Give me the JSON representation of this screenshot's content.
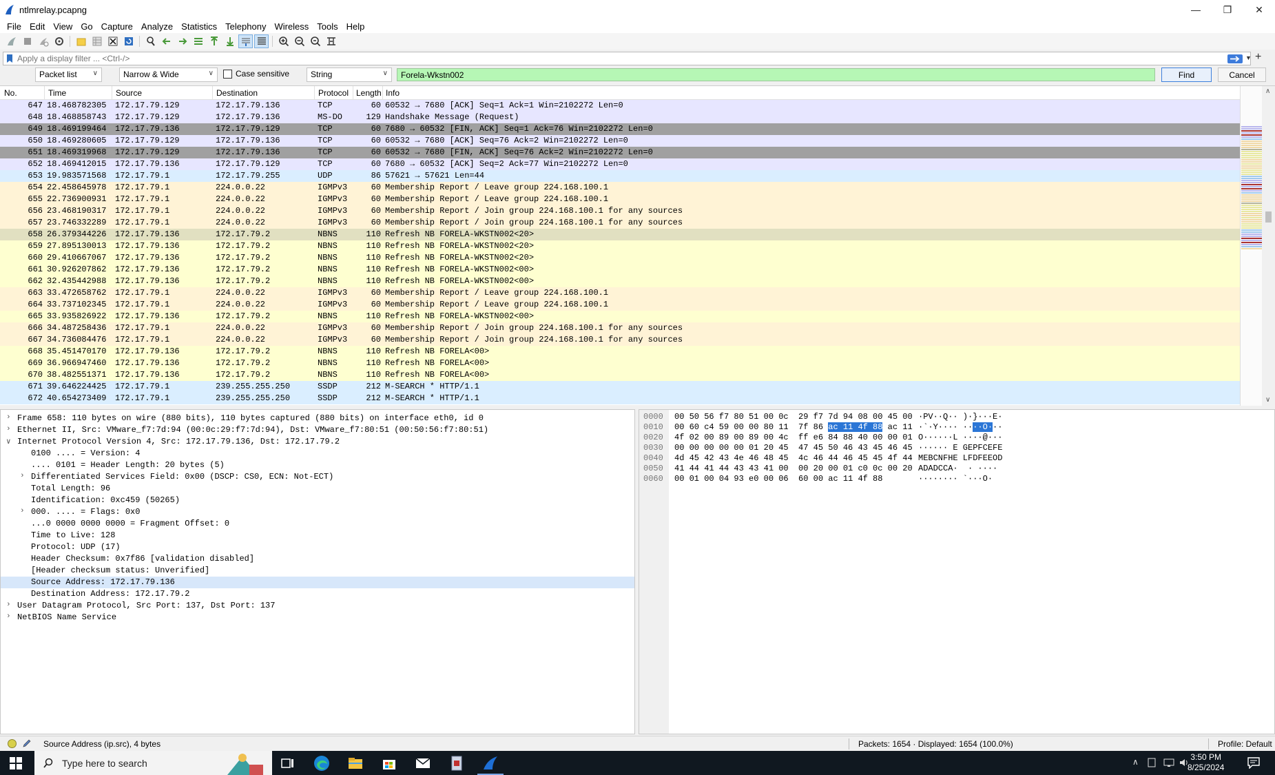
{
  "window": {
    "title": "ntlmrelay.pcapng"
  },
  "menu": [
    "File",
    "Edit",
    "View",
    "Go",
    "Capture",
    "Analyze",
    "Statistics",
    "Telephony",
    "Wireless",
    "Tools",
    "Help"
  ],
  "filter": {
    "placeholder": "Apply a display filter ... <Ctrl-/>"
  },
  "find": {
    "search_in": "Packet list",
    "char_width": "Narrow & Wide",
    "case_sensitive_label": "Case sensitive",
    "case_sensitive": false,
    "search_type": "String",
    "query": "Forela-Wkstn002",
    "find_label": "Find",
    "cancel_label": "Cancel"
  },
  "packet_list": {
    "columns": [
      "No.",
      "Time",
      "Source",
      "Destination",
      "Protocol",
      "Length",
      "Info"
    ],
    "rows": [
      {
        "no": "647",
        "time": "18.468782305",
        "src": "172.17.79.129",
        "dst": "172.17.79.136",
        "proto": "TCP",
        "len": "60",
        "info": "60532 → 7680 [ACK] Seq=1 Ack=1 Win=2102272 Len=0",
        "cls": "bg-tcp"
      },
      {
        "no": "648",
        "time": "18.468858743",
        "src": "172.17.79.129",
        "dst": "172.17.79.136",
        "proto": "MS-DO",
        "len": "129",
        "info": "Handshake Message (Request)",
        "cls": "bg-tcp"
      },
      {
        "no": "649",
        "time": "18.469199464",
        "src": "172.17.79.136",
        "dst": "172.17.79.129",
        "proto": "TCP",
        "len": "60",
        "info": "7680 → 60532 [FIN, ACK] Seq=1 Ack=76 Win=2102272 Len=0",
        "cls": "bg-tcpdark"
      },
      {
        "no": "650",
        "time": "18.469280605",
        "src": "172.17.79.129",
        "dst": "172.17.79.136",
        "proto": "TCP",
        "len": "60",
        "info": "60532 → 7680 [ACK] Seq=76 Ack=2 Win=2102272 Len=0",
        "cls": "bg-tcp"
      },
      {
        "no": "651",
        "time": "18.469319968",
        "src": "172.17.79.129",
        "dst": "172.17.79.136",
        "proto": "TCP",
        "len": "60",
        "info": "60532 → 7680 [FIN, ACK] Seq=76 Ack=2 Win=2102272 Len=0",
        "cls": "bg-tcpdark"
      },
      {
        "no": "652",
        "time": "18.469412015",
        "src": "172.17.79.136",
        "dst": "172.17.79.129",
        "proto": "TCP",
        "len": "60",
        "info": "7680 → 60532 [ACK] Seq=2 Ack=77 Win=2102272 Len=0",
        "cls": "bg-tcp"
      },
      {
        "no": "653",
        "time": "19.983571568",
        "src": "172.17.79.1",
        "dst": "172.17.79.255",
        "proto": "UDP",
        "len": "86",
        "info": "57621 → 57621 Len=44",
        "cls": "bg-udp"
      },
      {
        "no": "654",
        "time": "22.458645978",
        "src": "172.17.79.1",
        "dst": "224.0.0.22",
        "proto": "IGMPv3",
        "len": "60",
        "info": "Membership Report / Leave group 224.168.100.1",
        "cls": "bg-igmp"
      },
      {
        "no": "655",
        "time": "22.736900931",
        "src": "172.17.79.1",
        "dst": "224.0.0.22",
        "proto": "IGMPv3",
        "len": "60",
        "info": "Membership Report / Leave group 224.168.100.1",
        "cls": "bg-igmp"
      },
      {
        "no": "656",
        "time": "23.468190317",
        "src": "172.17.79.1",
        "dst": "224.0.0.22",
        "proto": "IGMPv3",
        "len": "60",
        "info": "Membership Report / Join group 224.168.100.1 for any sources",
        "cls": "bg-igmp"
      },
      {
        "no": "657",
        "time": "23.746332289",
        "src": "172.17.79.1",
        "dst": "224.0.0.22",
        "proto": "IGMPv3",
        "len": "60",
        "info": "Membership Report / Join group 224.168.100.1 for any sources",
        "cls": "bg-igmp"
      },
      {
        "no": "658",
        "time": "26.379344226",
        "src": "172.17.79.136",
        "dst": "172.17.79.2",
        "proto": "NBNS",
        "len": "110",
        "info": "Refresh NB FORELA-WKSTN002<20>",
        "cls": "bg-nbnssel"
      },
      {
        "no": "659",
        "time": "27.895130013",
        "src": "172.17.79.136",
        "dst": "172.17.79.2",
        "proto": "NBNS",
        "len": "110",
        "info": "Refresh NB FORELA-WKSTN002<20>",
        "cls": "bg-nbns"
      },
      {
        "no": "660",
        "time": "29.410667067",
        "src": "172.17.79.136",
        "dst": "172.17.79.2",
        "proto": "NBNS",
        "len": "110",
        "info": "Refresh NB FORELA-WKSTN002<20>",
        "cls": "bg-nbns"
      },
      {
        "no": "661",
        "time": "30.926207862",
        "src": "172.17.79.136",
        "dst": "172.17.79.2",
        "proto": "NBNS",
        "len": "110",
        "info": "Refresh NB FORELA-WKSTN002<00>",
        "cls": "bg-nbns"
      },
      {
        "no": "662",
        "time": "32.435442988",
        "src": "172.17.79.136",
        "dst": "172.17.79.2",
        "proto": "NBNS",
        "len": "110",
        "info": "Refresh NB FORELA-WKSTN002<00>",
        "cls": "bg-nbns"
      },
      {
        "no": "663",
        "time": "33.472658762",
        "src": "172.17.79.1",
        "dst": "224.0.0.22",
        "proto": "IGMPv3",
        "len": "60",
        "info": "Membership Report / Leave group 224.168.100.1",
        "cls": "bg-igmp"
      },
      {
        "no": "664",
        "time": "33.737102345",
        "src": "172.17.79.1",
        "dst": "224.0.0.22",
        "proto": "IGMPv3",
        "len": "60",
        "info": "Membership Report / Leave group 224.168.100.1",
        "cls": "bg-igmp"
      },
      {
        "no": "665",
        "time": "33.935826922",
        "src": "172.17.79.136",
        "dst": "172.17.79.2",
        "proto": "NBNS",
        "len": "110",
        "info": "Refresh NB FORELA-WKSTN002<00>",
        "cls": "bg-nbns"
      },
      {
        "no": "666",
        "time": "34.487258436",
        "src": "172.17.79.1",
        "dst": "224.0.0.22",
        "proto": "IGMPv3",
        "len": "60",
        "info": "Membership Report / Join group 224.168.100.1 for any sources",
        "cls": "bg-igmp"
      },
      {
        "no": "667",
        "time": "34.736084476",
        "src": "172.17.79.1",
        "dst": "224.0.0.22",
        "proto": "IGMPv3",
        "len": "60",
        "info": "Membership Report / Join group 224.168.100.1 for any sources",
        "cls": "bg-igmp"
      },
      {
        "no": "668",
        "time": "35.451470170",
        "src": "172.17.79.136",
        "dst": "172.17.79.2",
        "proto": "NBNS",
        "len": "110",
        "info": "Refresh NB FORELA<00>",
        "cls": "bg-nbns"
      },
      {
        "no": "669",
        "time": "36.966947460",
        "src": "172.17.79.136",
        "dst": "172.17.79.2",
        "proto": "NBNS",
        "len": "110",
        "info": "Refresh NB FORELA<00>",
        "cls": "bg-nbns"
      },
      {
        "no": "670",
        "time": "38.482551371",
        "src": "172.17.79.136",
        "dst": "172.17.79.2",
        "proto": "NBNS",
        "len": "110",
        "info": "Refresh NB FORELA<00>",
        "cls": "bg-nbns"
      },
      {
        "no": "671",
        "time": "39.646224425",
        "src": "172.17.79.1",
        "dst": "239.255.255.250",
        "proto": "SSDP",
        "len": "212",
        "info": "M-SEARCH * HTTP/1.1",
        "cls": "bg-ssdp"
      },
      {
        "no": "672",
        "time": "40.654273409",
        "src": "172.17.79.1",
        "dst": "239.255.255.250",
        "proto": "SSDP",
        "len": "212",
        "info": "M-SEARCH * HTTP/1.1",
        "cls": "bg-ssdp"
      }
    ]
  },
  "details": [
    {
      "indent": 0,
      "exp": ">",
      "text": "Frame 658: 110 bytes on wire (880 bits), 110 bytes captured (880 bits) on interface eth0, id 0"
    },
    {
      "indent": 0,
      "exp": ">",
      "text": "Ethernet II, Src: VMware_f7:7d:94 (00:0c:29:f7:7d:94), Dst: VMware_f7:80:51 (00:50:56:f7:80:51)"
    },
    {
      "indent": 0,
      "exp": "v",
      "text": "Internet Protocol Version 4, Src: 172.17.79.136, Dst: 172.17.79.2"
    },
    {
      "indent": 1,
      "exp": "",
      "text": "0100 .... = Version: 4"
    },
    {
      "indent": 1,
      "exp": "",
      "text": ".... 0101 = Header Length: 20 bytes (5)"
    },
    {
      "indent": 1,
      "exp": ">",
      "text": "Differentiated Services Field: 0x00 (DSCP: CS0, ECN: Not-ECT)"
    },
    {
      "indent": 1,
      "exp": "",
      "text": "Total Length: 96"
    },
    {
      "indent": 1,
      "exp": "",
      "text": "Identification: 0xc459 (50265)"
    },
    {
      "indent": 1,
      "exp": ">",
      "text": "000. .... = Flags: 0x0"
    },
    {
      "indent": 1,
      "exp": "",
      "text": "...0 0000 0000 0000 = Fragment Offset: 0"
    },
    {
      "indent": 1,
      "exp": "",
      "text": "Time to Live: 128"
    },
    {
      "indent": 1,
      "exp": "",
      "text": "Protocol: UDP (17)"
    },
    {
      "indent": 1,
      "exp": "",
      "text": "Header Checksum: 0x7f86 [validation disabled]"
    },
    {
      "indent": 1,
      "exp": "",
      "text": "[Header checksum status: Unverified]"
    },
    {
      "indent": 1,
      "exp": "",
      "text": "Source Address: 172.17.79.136",
      "sel": true
    },
    {
      "indent": 1,
      "exp": "",
      "text": "Destination Address: 172.17.79.2"
    },
    {
      "indent": 0,
      "exp": ">",
      "text": "User Datagram Protocol, Src Port: 137, Dst Port: 137"
    },
    {
      "indent": 0,
      "exp": ">",
      "text": "NetBIOS Name Service"
    }
  ],
  "bytes": [
    {
      "off": "0000",
      "hex_a": "00 50 56 f7 80 51 00 0c  29 f7 7d 94 08 00 45 00",
      "hex_hl": "",
      "hex_b": "",
      "asc_a": "·PV··Q·· )·}···E·",
      "asc_hl": "",
      "asc_b": ""
    },
    {
      "off": "0010",
      "hex_a": "00 60 c4 59 00 00 80 11  7f 86 ",
      "hex_hl": "ac 11 4f 88",
      "hex_b": " ac 11",
      "asc_a": "·`·Y···· ··",
      "asc_hl": "··O·",
      "asc_b": "··"
    },
    {
      "off": "0020",
      "hex_a": "4f 02 00 89 00 89 00 4c  ff e6 84 88 40 00 00 01",
      "hex_hl": "",
      "hex_b": "",
      "asc_a": "O······L ····@···",
      "asc_hl": "",
      "asc_b": ""
    },
    {
      "off": "0030",
      "hex_a": "00 00 00 00 00 01 20 45  47 45 50 46 43 45 46 45",
      "hex_hl": "",
      "hex_b": "",
      "asc_a": "······ E GEPFCEFE",
      "asc_hl": "",
      "asc_b": ""
    },
    {
      "off": "0040",
      "hex_a": "4d 45 42 43 4e 46 48 45  4c 46 44 46 45 45 4f 44",
      "hex_hl": "",
      "hex_b": "",
      "asc_a": "MEBCNFHE LFDFEEOD",
      "asc_hl": "",
      "asc_b": ""
    },
    {
      "off": "0050",
      "hex_a": "41 44 41 44 43 43 41 00  00 20 00 01 c0 0c 00 20",
      "hex_hl": "",
      "hex_b": "",
      "asc_a": "ADADCCA·  · ····  ",
      "asc_hl": "",
      "asc_b": ""
    },
    {
      "off": "0060",
      "hex_a": "00 01 00 04 93 e0 00 06  60 00 ac 11 4f 88",
      "hex_hl": "",
      "hex_b": "",
      "asc_a": "········ `···O·",
      "asc_hl": "",
      "asc_b": ""
    }
  ],
  "status": {
    "left": "Source Address (ip.src), 4 bytes",
    "mid": "Packets: 1654 · Displayed: 1654 (100.0%)",
    "right": "Profile: Default"
  },
  "taskbar": {
    "search_placeholder": "Type here to search",
    "time": "3:50 PM",
    "date": "8/25/2024"
  }
}
